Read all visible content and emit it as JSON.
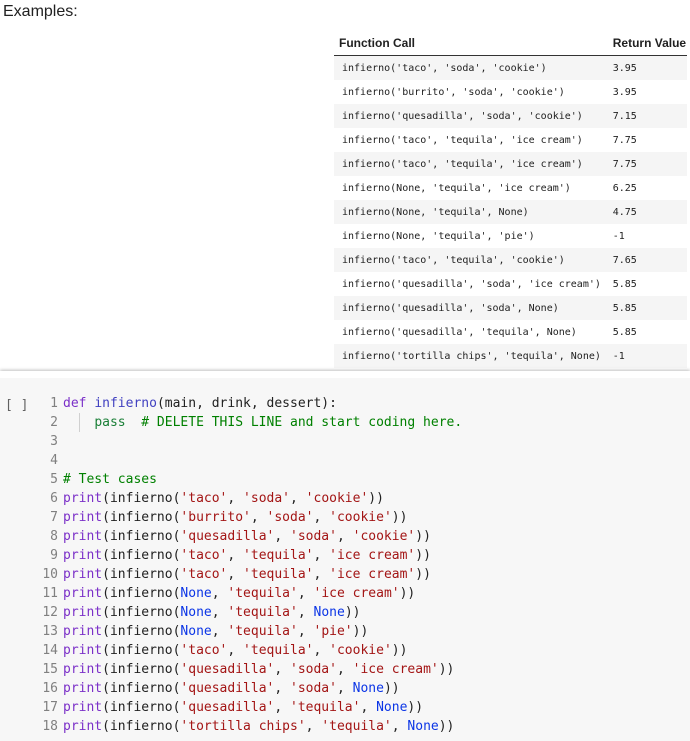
{
  "markdown": {
    "heading": "Examples:",
    "table": {
      "headers": [
        "Function Call",
        "Return Value"
      ],
      "rows": [
        [
          "infierno('taco', 'soda', 'cookie')",
          "3.95"
        ],
        [
          "infierno('burrito', 'soda', 'cookie')",
          "3.95"
        ],
        [
          "infierno('quesadilla', 'soda', 'cookie')",
          "7.15"
        ],
        [
          "infierno('taco', 'tequila', 'ice cream')",
          "7.75"
        ],
        [
          "infierno('taco', 'tequila', 'ice cream')",
          "7.75"
        ],
        [
          "infierno(None, 'tequila', 'ice cream')",
          "6.25"
        ],
        [
          "infierno(None, 'tequila', None)",
          "4.75"
        ],
        [
          "infierno(None, 'tequila', 'pie')",
          "-1"
        ],
        [
          "infierno('taco', 'tequila', 'cookie')",
          "7.65"
        ],
        [
          "infierno('quesadilla', 'soda', 'ice cream')",
          "5.85"
        ],
        [
          "infierno('quesadilla', 'soda', None)",
          "5.85"
        ],
        [
          "infierno('quesadilla', 'tequila', None)",
          "5.85"
        ],
        [
          "infierno('tortilla chips', 'tequila', None)",
          "-1"
        ]
      ]
    }
  },
  "code_cell": {
    "run_label": "[ ]",
    "lines": [
      {
        "n": "1",
        "tokens": [
          [
            "kw",
            "def"
          ],
          [
            "plain",
            " "
          ],
          [
            "fn",
            "infierno"
          ],
          [
            "plain",
            "(main, drink, dessert):"
          ]
        ]
      },
      {
        "n": "2",
        "indent": true,
        "tokens": [
          [
            "plain",
            "    "
          ],
          [
            "kw2",
            "pass"
          ],
          [
            "plain",
            "  "
          ],
          [
            "com",
            "# DELETE THIS LINE and start coding here."
          ]
        ]
      },
      {
        "n": "3",
        "tokens": []
      },
      {
        "n": "4",
        "tokens": []
      },
      {
        "n": "5",
        "tokens": [
          [
            "com",
            "# Test cases"
          ]
        ]
      },
      {
        "n": "6",
        "tokens": [
          [
            "bi",
            "print"
          ],
          [
            "plain",
            "(infierno("
          ],
          [
            "str",
            "'taco'"
          ],
          [
            "plain",
            ", "
          ],
          [
            "str",
            "'soda'"
          ],
          [
            "plain",
            ", "
          ],
          [
            "str",
            "'cookie'"
          ],
          [
            "plain",
            "))"
          ]
        ]
      },
      {
        "n": "7",
        "tokens": [
          [
            "bi",
            "print"
          ],
          [
            "plain",
            "(infierno("
          ],
          [
            "str",
            "'burrito'"
          ],
          [
            "plain",
            ", "
          ],
          [
            "str",
            "'soda'"
          ],
          [
            "plain",
            ", "
          ],
          [
            "str",
            "'cookie'"
          ],
          [
            "plain",
            "))"
          ]
        ]
      },
      {
        "n": "8",
        "tokens": [
          [
            "bi",
            "print"
          ],
          [
            "plain",
            "(infierno("
          ],
          [
            "str",
            "'quesadilla'"
          ],
          [
            "plain",
            ", "
          ],
          [
            "str",
            "'soda'"
          ],
          [
            "plain",
            ", "
          ],
          [
            "str",
            "'cookie'"
          ],
          [
            "plain",
            "))"
          ]
        ]
      },
      {
        "n": "9",
        "tokens": [
          [
            "bi",
            "print"
          ],
          [
            "plain",
            "(infierno("
          ],
          [
            "str",
            "'taco'"
          ],
          [
            "plain",
            ", "
          ],
          [
            "str",
            "'tequila'"
          ],
          [
            "plain",
            ", "
          ],
          [
            "str",
            "'ice cream'"
          ],
          [
            "plain",
            "))"
          ]
        ]
      },
      {
        "n": "10",
        "tokens": [
          [
            "bi",
            "print"
          ],
          [
            "plain",
            "(infierno("
          ],
          [
            "str",
            "'taco'"
          ],
          [
            "plain",
            ", "
          ],
          [
            "str",
            "'tequila'"
          ],
          [
            "plain",
            ", "
          ],
          [
            "str",
            "'ice cream'"
          ],
          [
            "plain",
            "))"
          ]
        ]
      },
      {
        "n": "11",
        "tokens": [
          [
            "bi",
            "print"
          ],
          [
            "plain",
            "(infierno("
          ],
          [
            "none",
            "None"
          ],
          [
            "plain",
            ", "
          ],
          [
            "str",
            "'tequila'"
          ],
          [
            "plain",
            ", "
          ],
          [
            "str",
            "'ice cream'"
          ],
          [
            "plain",
            "))"
          ]
        ]
      },
      {
        "n": "12",
        "tokens": [
          [
            "bi",
            "print"
          ],
          [
            "plain",
            "(infierno("
          ],
          [
            "none",
            "None"
          ],
          [
            "plain",
            ", "
          ],
          [
            "str",
            "'tequila'"
          ],
          [
            "plain",
            ", "
          ],
          [
            "none",
            "None"
          ],
          [
            "plain",
            "))"
          ]
        ]
      },
      {
        "n": "13",
        "tokens": [
          [
            "bi",
            "print"
          ],
          [
            "plain",
            "(infierno("
          ],
          [
            "none",
            "None"
          ],
          [
            "plain",
            ", "
          ],
          [
            "str",
            "'tequila'"
          ],
          [
            "plain",
            ", "
          ],
          [
            "str",
            "'pie'"
          ],
          [
            "plain",
            "))"
          ]
        ]
      },
      {
        "n": "14",
        "tokens": [
          [
            "bi",
            "print"
          ],
          [
            "plain",
            "(infierno("
          ],
          [
            "str",
            "'taco'"
          ],
          [
            "plain",
            ", "
          ],
          [
            "str",
            "'tequila'"
          ],
          [
            "plain",
            ", "
          ],
          [
            "str",
            "'cookie'"
          ],
          [
            "plain",
            "))"
          ]
        ]
      },
      {
        "n": "15",
        "tokens": [
          [
            "bi",
            "print"
          ],
          [
            "plain",
            "(infierno("
          ],
          [
            "str",
            "'quesadilla'"
          ],
          [
            "plain",
            ", "
          ],
          [
            "str",
            "'soda'"
          ],
          [
            "plain",
            ", "
          ],
          [
            "str",
            "'ice cream'"
          ],
          [
            "plain",
            "))"
          ]
        ]
      },
      {
        "n": "16",
        "tokens": [
          [
            "bi",
            "print"
          ],
          [
            "plain",
            "(infierno("
          ],
          [
            "str",
            "'quesadilla'"
          ],
          [
            "plain",
            ", "
          ],
          [
            "str",
            "'soda'"
          ],
          [
            "plain",
            ", "
          ],
          [
            "none",
            "None"
          ],
          [
            "plain",
            "))"
          ]
        ]
      },
      {
        "n": "17",
        "tokens": [
          [
            "bi",
            "print"
          ],
          [
            "plain",
            "(infierno("
          ],
          [
            "str",
            "'quesadilla'"
          ],
          [
            "plain",
            ", "
          ],
          [
            "str",
            "'tequila'"
          ],
          [
            "plain",
            ", "
          ],
          [
            "none",
            "None"
          ],
          [
            "plain",
            "))"
          ]
        ]
      },
      {
        "n": "18",
        "tokens": [
          [
            "bi",
            "print"
          ],
          [
            "plain",
            "(infierno("
          ],
          [
            "str",
            "'tortilla chips'"
          ],
          [
            "plain",
            ", "
          ],
          [
            "str",
            "'tequila'"
          ],
          [
            "plain",
            ", "
          ],
          [
            "none",
            "None"
          ],
          [
            "plain",
            "))"
          ]
        ]
      }
    ]
  }
}
